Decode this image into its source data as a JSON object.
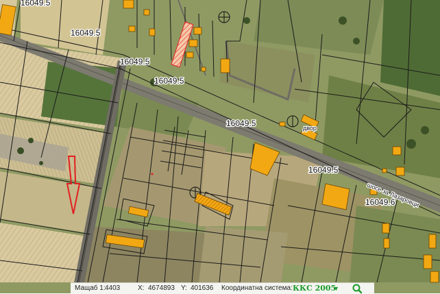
{
  "map": {
    "labels": {
      "parcel_a": "16049.5",
      "parcel_b": "16049.5",
      "parcel_c": "16049.5",
      "parcel_d": "16049.5",
      "parcel_e": "16049.5",
      "parcel_f": "16049.5",
      "parcel_g": "16049.6",
      "area_dvor": "двор",
      "road_name": "шосе за Лазаровци"
    }
  },
  "status_bar": {
    "scale_label": "Мащаб 1:",
    "scale_value": "4403",
    "x_label": "X:",
    "x_value": "4674893",
    "y_label": "Y:",
    "y_value": "401636",
    "crs_label": "Координатна система:",
    "crs_value": "ККС 2005",
    "dropdown_glyph": "▼",
    "search_icon": "search-icon"
  },
  "colors": {
    "building": "#f2a813",
    "parcel_line": "#1a1a1a",
    "highlight": "#e02020",
    "crs_text": "#1a9a2a"
  }
}
